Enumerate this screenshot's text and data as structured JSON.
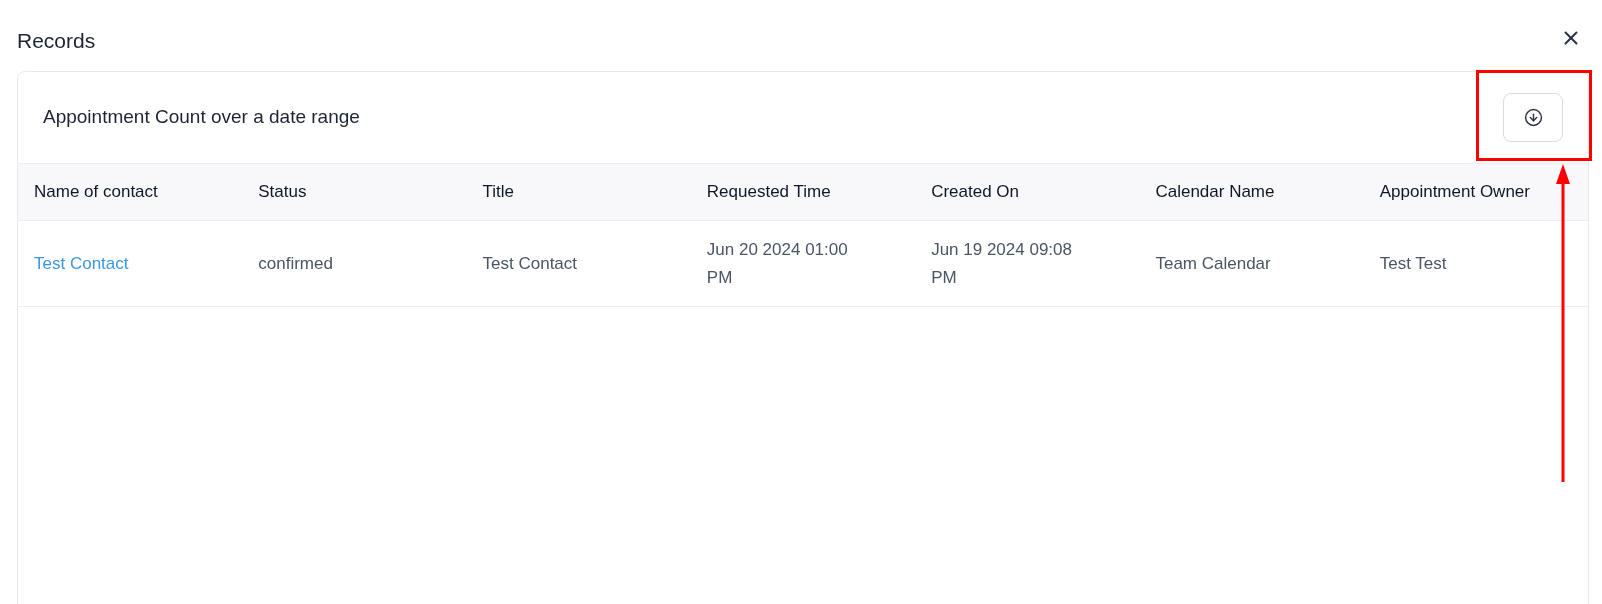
{
  "dialog": {
    "title": "Records"
  },
  "report": {
    "title": "Appointment Count over a date range"
  },
  "table": {
    "columns": [
      "Name of contact",
      "Status",
      "Title",
      "Requested Time",
      "Created On",
      "Calendar Name",
      "Appointment Owner"
    ],
    "rows": [
      {
        "cells": [
          {
            "kind": "link",
            "text": "Test Contact"
          },
          {
            "kind": "text",
            "text": "confirmed"
          },
          {
            "kind": "text",
            "text": "Test Contact"
          },
          {
            "kind": "text",
            "text": "Jun 20 2024 01:00 PM"
          },
          {
            "kind": "text",
            "text": "Jun 19 2024 09:08 PM"
          },
          {
            "kind": "text",
            "text": "Team Calendar"
          },
          {
            "kind": "text",
            "text": "Test Test"
          }
        ]
      }
    ]
  }
}
